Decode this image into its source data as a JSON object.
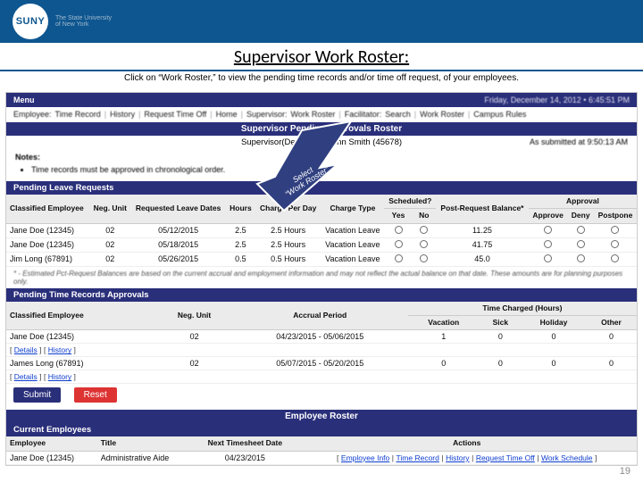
{
  "logo": {
    "short": "SUNY",
    "full": "The State University\nof New York"
  },
  "title": "Supervisor Work Roster:",
  "subtitle": "Click on “Work Roster,” to view the pending time records and/or time off request, of your employees.",
  "menu": {
    "label": "Menu",
    "datetime": "Friday, December 14, 2012 • 6:45:51 PM"
  },
  "nav": {
    "prefix": "Employee:",
    "items": [
      "Time Record",
      "History",
      "Request Time Off",
      "Home"
    ],
    "prefix2": "Supervisor:",
    "items2": [
      "Work Roster"
    ],
    "prefix3": "Facilitator:",
    "items3": [
      "Search",
      "Work Roster"
    ],
    "tail": [
      "Campus Rules"
    ]
  },
  "section_header": "Supervisor Pending Approvals Roster",
  "supervisor_line": "Supervisor(Designee): John Smith (45678)",
  "as_submitted": "As submitted at 9:50:13 AM",
  "notes": {
    "label": "Notes:",
    "items": [
      "Time records must be approved in chronological order."
    ]
  },
  "callout": {
    "line1": "Select",
    "line2": "“Work Roster”"
  },
  "leave_header": "Pending Leave Requests",
  "leave_columns": [
    "Classified Employee",
    "Neg. Unit",
    "Requested Leave Dates",
    "Hours",
    "Charge Per Day",
    "Charge Type",
    "Scheduled?",
    "Yes",
    "No",
    "Post-Request Balance*",
    "Approval",
    "Approve",
    "Deny",
    "Postpone"
  ],
  "leave_rows": [
    {
      "emp": "Jane Doe (12345)",
      "neg": "02",
      "date": "05/12/2015",
      "hrs": "2.5",
      "cpd": "2.5 Hours",
      "type": "Vacation Leave",
      "bal": "11.25"
    },
    {
      "emp": "Jane Doe (12345)",
      "neg": "02",
      "date": "05/18/2015",
      "hrs": "2.5",
      "cpd": "2.5 Hours",
      "type": "Vacation Leave",
      "bal": "41.75"
    },
    {
      "emp": "Jim Long (67891)",
      "neg": "02",
      "date": "05/26/2015",
      "hrs": "0.5",
      "cpd": "0.5 Hours",
      "type": "Vacation Leave",
      "bal": "45.0"
    }
  ],
  "leave_footnote": "* - Estimated Pct-Request Balances are based on the current accrual and employment information and may not reflect the actual balance on that date. These amounts are for planning purposes only.",
  "tr_header": "Pending Time Records Approvals",
  "tr_columns_top": "Time Charged (Hours)",
  "tr_columns": [
    "Classified Employee",
    "Neg. Unit",
    "Accrual Period",
    "Vacation",
    "Sick",
    "Holiday",
    "Other"
  ],
  "tr_rows": [
    {
      "emp": "Jane Doe (12345)",
      "neg": "02",
      "period": "04/23/2015 - 05/06/2015",
      "vac": "1",
      "sick": "0",
      "hol": "0",
      "oth": "0"
    },
    {
      "emp": "James Long (67891)",
      "neg": "02",
      "period": "05/07/2015 - 05/20/2015",
      "vac": "0",
      "sick": "0",
      "hol": "0",
      "oth": "0"
    }
  ],
  "links": {
    "details": "Details",
    "history": "History"
  },
  "buttons": {
    "submit": "Submit",
    "reset": "Reset"
  },
  "roster_header": "Employee Roster",
  "roster_sub": "Current Employees",
  "roster_columns": [
    "Employee",
    "Title",
    "Next Timesheet Date",
    "Actions"
  ],
  "roster_row": {
    "emp": "Jane Doe (12345)",
    "title": "Administrative Aide",
    "date": "04/23/2015",
    "actions": [
      "Employee Info",
      "Time Record",
      "History",
      "Request Time Off",
      "Work Schedule"
    ]
  },
  "page_number": "19"
}
